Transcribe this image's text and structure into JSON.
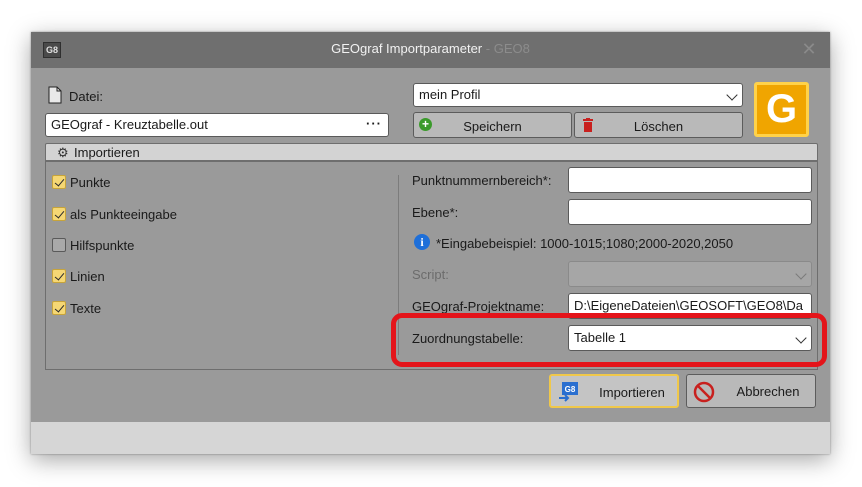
{
  "window": {
    "title": "GEOgraf Importparameter",
    "title_sub": "- GEO8",
    "app_icon_text": "G8",
    "close_glyph": "✕"
  },
  "file": {
    "label": "Datei:",
    "value": "GEOgraf - Kreuztabelle.out",
    "browse": "···"
  },
  "profile": {
    "selected": "mein Profil",
    "save_label": "Speichern",
    "delete_label": "Löschen",
    "logo_letter": "G"
  },
  "section": {
    "title": "Importieren"
  },
  "options": [
    {
      "label": "Punkte",
      "checked": true
    },
    {
      "label": "als Punkteeingabe",
      "checked": true
    },
    {
      "label": "Hilfspunkte",
      "checked": false
    },
    {
      "label": "Linien",
      "checked": true
    },
    {
      "label": "Texte",
      "checked": true
    }
  ],
  "form": {
    "range_label": "Punktnummernbereich*:",
    "range_value": "",
    "layer_label": "Ebene*:",
    "layer_value": "",
    "hint": "*Eingabebeispiel: 1000-1015;1080;2000-2020,2050",
    "script_label": "Script:",
    "script_value": "",
    "project_label": "GEOgraf-Projektname:",
    "project_value": "D:\\EigeneDateien\\GEOSOFT\\GEO8\\Da",
    "mapping_label": "Zuordnungstabelle:",
    "mapping_value": "Tabelle 1"
  },
  "actions": {
    "import_label": "Importieren",
    "import_icon_text": "G8",
    "cancel_label": "Abbrechen"
  },
  "colors": {
    "accent_yellow": "#f5d774",
    "logo_orange": "#f0a500",
    "highlight_red": "#e4141a",
    "save_green": "#3a9a2a",
    "delete_red": "#c8201e",
    "info_blue": "#1e6fd9"
  }
}
